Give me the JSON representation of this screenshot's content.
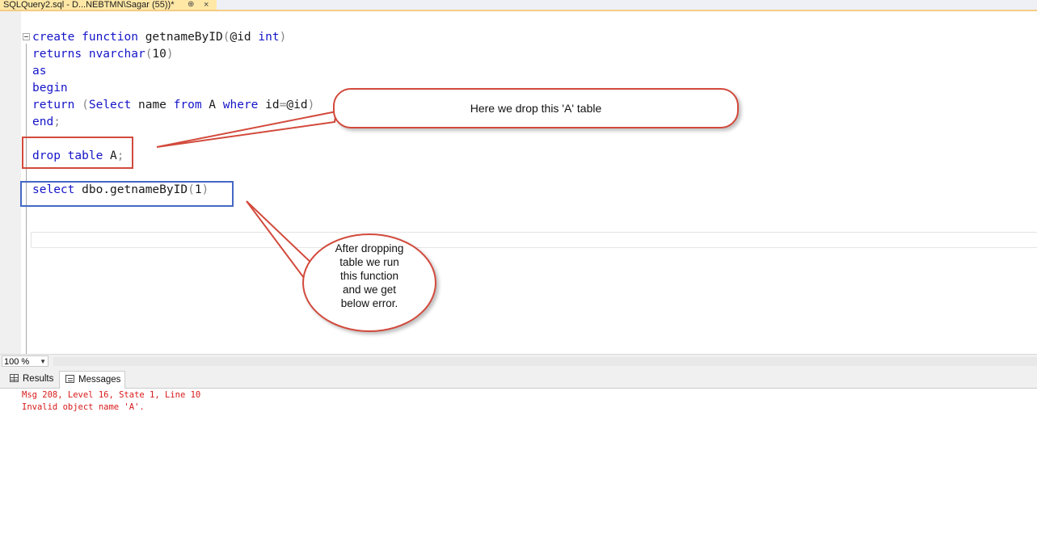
{
  "tab": {
    "title": "SQLQuery2.sql - D...NEBTMN\\Sagar (55))*",
    "pin_glyph": "⊕",
    "close_glyph": "×"
  },
  "editor": {
    "line1": {
      "kw_create": "create",
      "kw_function": "function",
      "name": "getnameByID",
      "open": "(",
      "param": "@id",
      "type": "int",
      "close": ")"
    },
    "line2": {
      "kw": "returns",
      "type": "nvarchar",
      "open": "(",
      "num": "10",
      "close": ")"
    },
    "line3": {
      "kw": "as"
    },
    "line4": {
      "kw": "begin"
    },
    "line5": {
      "kw_return": "return",
      "open": "(",
      "kw_select": "Select",
      "col": "name",
      "kw_from": "from",
      "table": "A",
      "kw_where": "where",
      "id": "id",
      "eq": "=",
      "param": "@id",
      "close": ")"
    },
    "line6": {
      "kw": "end",
      "semi": ";"
    },
    "line7": {
      "kw_drop": "drop",
      "kw_table": "table",
      "table": "A",
      "semi": ";"
    },
    "line8": {
      "kw": "select",
      "call": "dbo.getnameByID",
      "open": "(",
      "num": "1",
      "close": ")"
    }
  },
  "annotations": {
    "top_callout": "Here we drop this 'A' table",
    "oval_callout": "After dropping\ntable we run\nthis function\n and we get\nbelow error."
  },
  "zoom": {
    "value": "100 %",
    "arrow": "▼"
  },
  "result_tabs": {
    "results": "Results",
    "messages": "Messages"
  },
  "messages": {
    "line1": "Msg 208, Level 16, State 1, Line 10",
    "line2": "Invalid object name 'A'."
  },
  "colors": {
    "keyword": "#1414c8",
    "function": "#b400b4",
    "error": "#d81a1a",
    "callout_border": "#d24a3c",
    "blue_box": "#4468c4"
  }
}
